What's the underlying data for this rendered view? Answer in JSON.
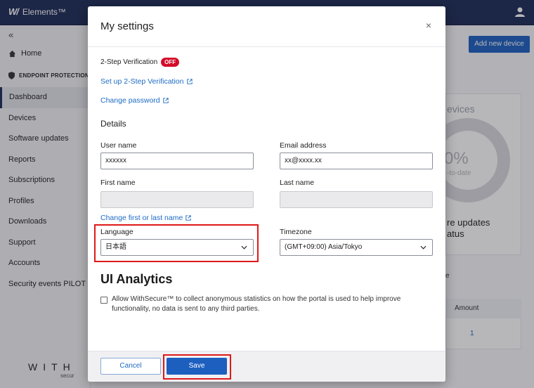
{
  "app": {
    "brand_mark": "W/",
    "brand_name": "Elements™"
  },
  "sidebar": {
    "collapse": "«",
    "home": "Home",
    "product": "ENDPOINT PROTECTION",
    "items": [
      {
        "label": "Dashboard",
        "active": true
      },
      {
        "label": "Devices"
      },
      {
        "label": "Software updates"
      },
      {
        "label": "Reports"
      },
      {
        "label": "Subscriptions"
      },
      {
        "label": "Profiles"
      },
      {
        "label": "Downloads"
      },
      {
        "label": "Support"
      },
      {
        "label": "Accounts"
      },
      {
        "label": "Security events PILOT"
      }
    ],
    "logo": "WITH",
    "logo_sub": "secur"
  },
  "background": {
    "add_device": "Add new device",
    "devices": "evices",
    "pct": "0%",
    "todate": "-to-date",
    "updates_line1": "re updates",
    "updates_line2": "atus",
    "e_text": "e",
    "amount": "Amount",
    "amount_value": "1"
  },
  "modal": {
    "title": "My settings",
    "close": "×",
    "two_step_label": "2-Step Verification",
    "two_step_badge": "OFF",
    "setup_link": "Set up 2-Step Verification",
    "change_password_link": "Change password",
    "details_heading": "Details",
    "fields": {
      "user_name_label": "User name",
      "user_name_value": "xxxxxx",
      "email_label": "Email address",
      "email_value": "xx@xxxx.xx",
      "first_name_label": "First name",
      "first_name_value": "",
      "last_name_label": "Last name",
      "last_name_value": "",
      "change_name_link": "Change first or last name",
      "language_label": "Language",
      "language_value": "日本語",
      "timezone_label": "Timezone",
      "timezone_value": "(GMT+09:00) Asia/Tokyo"
    },
    "ui_analytics_heading": "UI Analytics",
    "analytics_checked": false,
    "analytics_text": "Allow WithSecure™ to collect anonymous statistics on how the portal is used to help improve functionality, no data is sent to any third parties.",
    "cancel_label": "Cancel",
    "save_label": "Save"
  },
  "colors": {
    "topbar": "#1b2a55",
    "link": "#1d6bc4",
    "primary": "#1d5fbf",
    "badge_off": "#d40b2a",
    "highlight": "#e01818"
  },
  "icons": [
    "user-icon",
    "home-icon",
    "shield-icon",
    "external-link-icon",
    "chevron-down-icon",
    "close-icon"
  ]
}
